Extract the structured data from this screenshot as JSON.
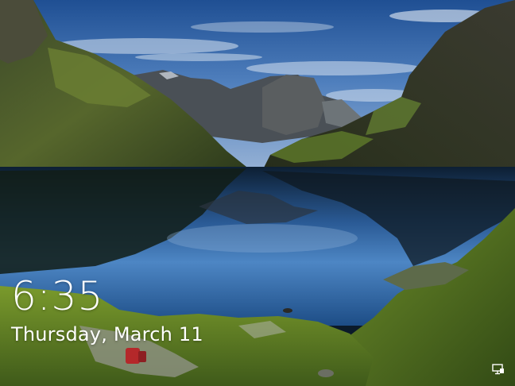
{
  "lock_screen": {
    "time": "6:35",
    "date": "Thursday, March 11",
    "status_icons": [
      "network-icon"
    ]
  }
}
